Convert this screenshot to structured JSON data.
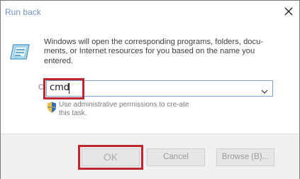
{
  "window": {
    "title": "Run back",
    "close_icon": "close-icon"
  },
  "body": {
    "icon": "run-icon",
    "description": "Windows will open the corresponding programs, folders, docu-ments, or Internet resources for you based on the name you entered.",
    "open_label": "O",
    "command_value": "cmd",
    "admin_note": "Use administrative permissions to cre-ate this task."
  },
  "buttons": {
    "ok": "OK",
    "cancel": "Cancel",
    "browse": "Browse (B)..."
  },
  "colors": {
    "highlight": "#c0272d",
    "title": "#6f93bf",
    "footer_bg": "#f0f0f0"
  }
}
